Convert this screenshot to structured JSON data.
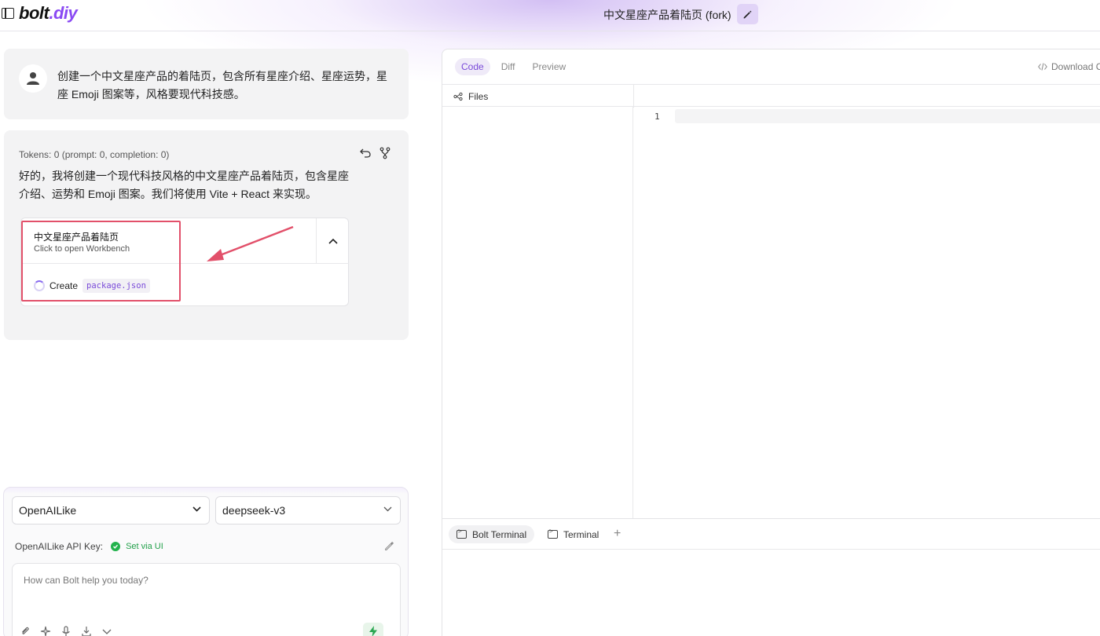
{
  "app": {
    "logo_main": "bolt",
    "logo_accent": ".diy",
    "chat_title": "中文星座产品着陆页 (fork)"
  },
  "chat": {
    "user_message": "创建一个中文星座产品的着陆页，包含所有星座介绍、星座运势，星座 Emoji 图案等，风格要现代科技感。",
    "tokens": "Tokens: 0 (prompt: 0, completion: 0)",
    "assistant_message": "好的，我将创建一个现代科技风格的中文星座产品着陆页，包含星座介绍、运势和 Emoji 图案。我们将使用 Vite + React 来实现。",
    "artifact": {
      "title": "中文星座产品着陆页",
      "subtitle": "Click to open Workbench",
      "action_verb": "Create",
      "action_file": "package.json"
    }
  },
  "input": {
    "provider": "OpenAILike",
    "model": "deepseek-v3",
    "api_key_label": "OpenAILike API Key:",
    "api_key_status": "Set via UI",
    "placeholder": "How can Bolt help you today?"
  },
  "workbench": {
    "tabs": [
      "Code",
      "Diff",
      "Preview"
    ],
    "download_label": "Download C",
    "files_label": "Files",
    "line_number": "1",
    "terminal_tabs": [
      "Bolt Terminal",
      "Terminal"
    ],
    "add_terminal": "+"
  },
  "colors": {
    "accent": "#8a4af3",
    "highlight_box": "#e2506a",
    "status_ok": "#22b24c"
  }
}
